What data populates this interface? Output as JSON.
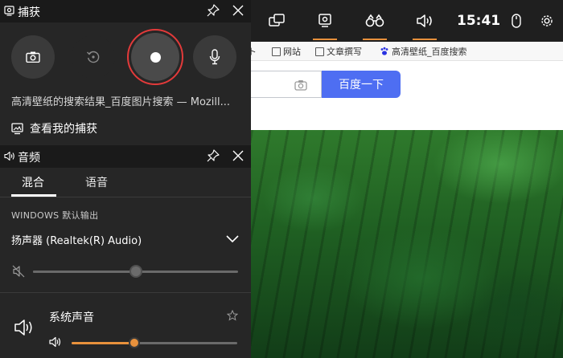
{
  "capture_panel": {
    "title": "捕获",
    "window_title": "高清壁纸的搜索结果_百度图片搜索 — Mozill...",
    "view_captures": "查看我的捕获"
  },
  "audio_panel": {
    "title": "音频",
    "tabs": [
      "混合",
      "语音"
    ],
    "default_output_label": "WINDOWS 默认输出",
    "device": "扬声器 (Realtek(R) Audio)",
    "master_volume_fraction": 0.5,
    "system_sounds_label": "系统声音",
    "system_sounds_volume_fraction": 0.38
  },
  "topbar": {
    "clock": "15:41"
  },
  "browser": {
    "bookmarks": [
      "网站",
      "文章撰写",
      "高清壁纸_百度搜索"
    ],
    "search_button": "百度一下"
  },
  "colors": {
    "accent": "#e8913c",
    "record_ring": "#e23a3a",
    "baidu_blue": "#4e6ef2"
  }
}
